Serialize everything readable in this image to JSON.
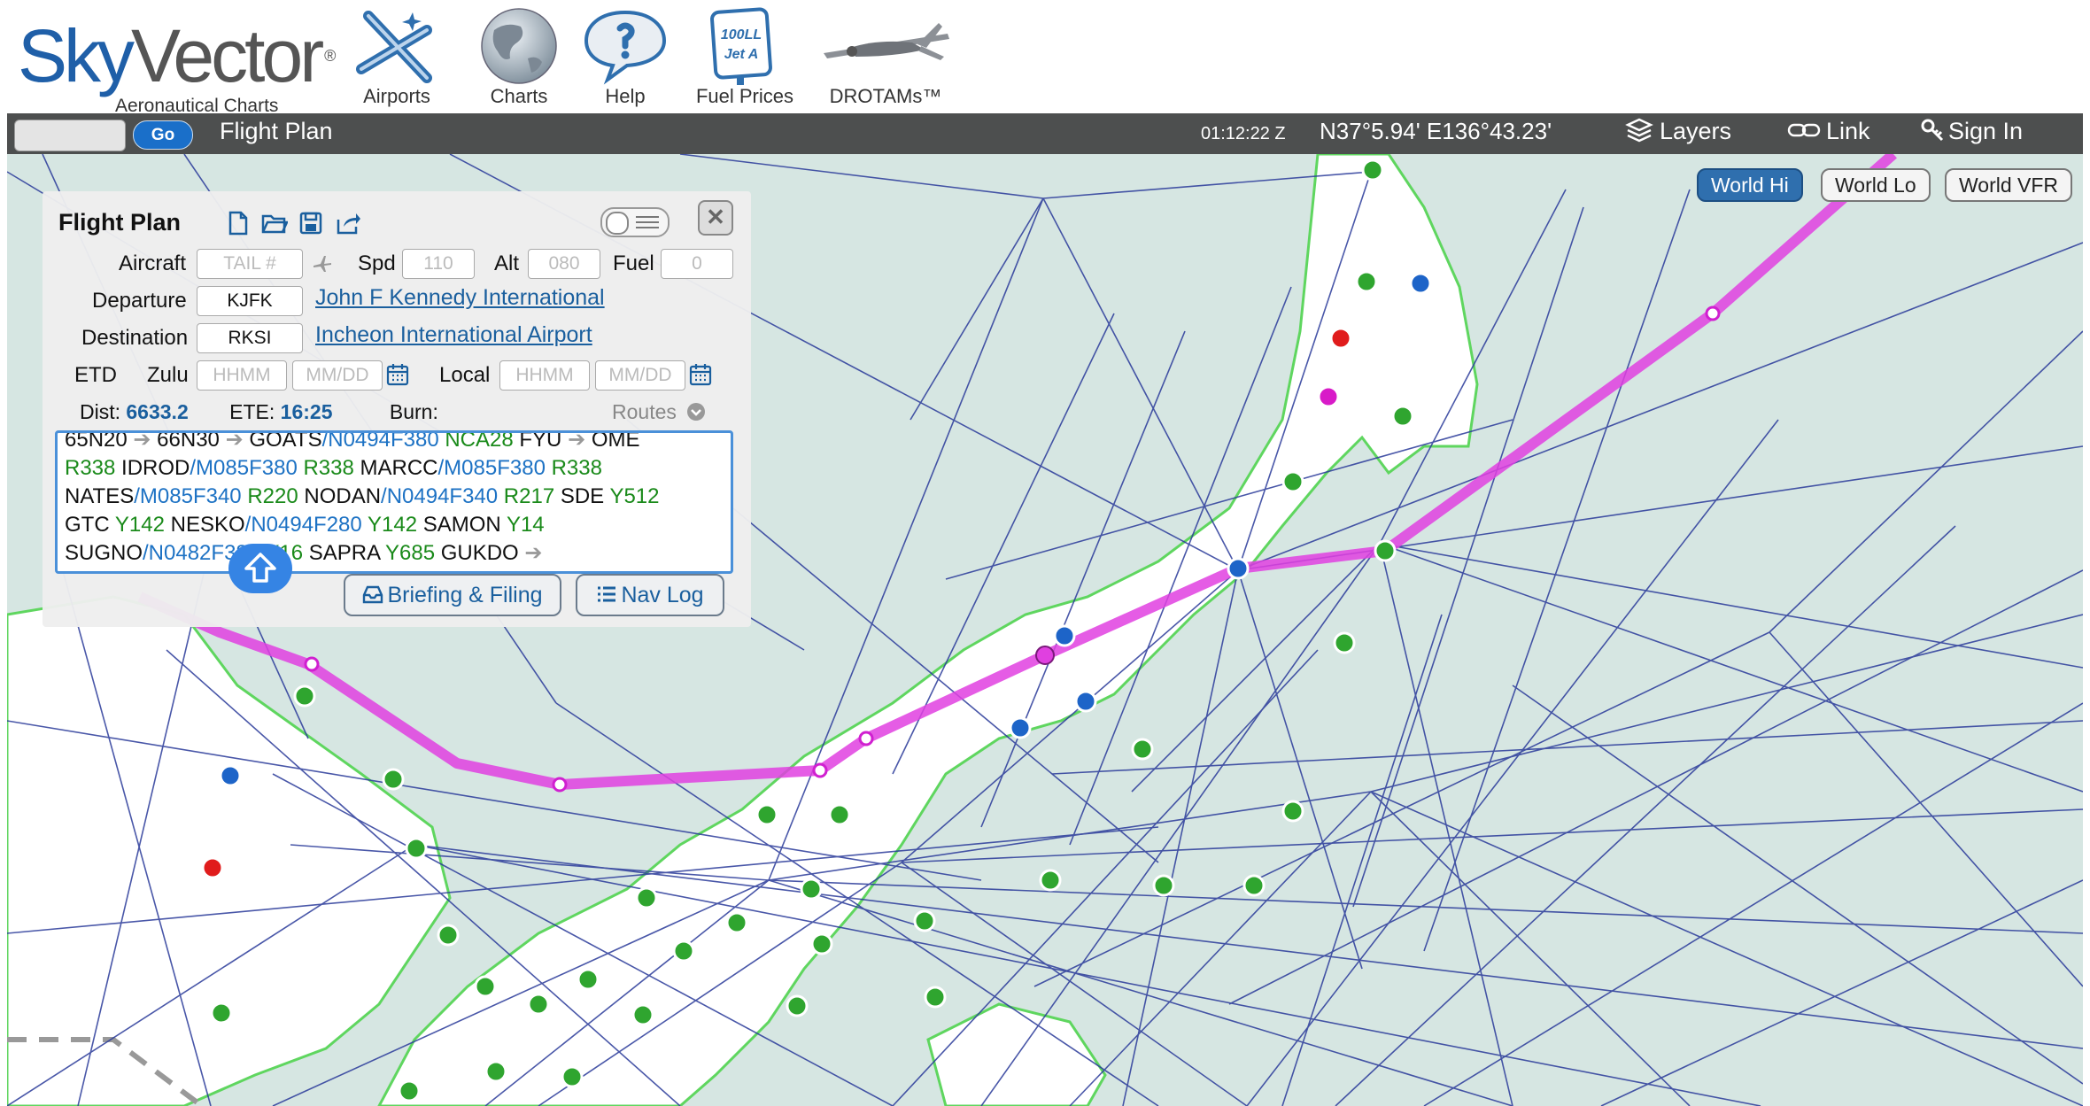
{
  "header": {
    "logo_sky": "Sky",
    "logo_vector": "Vector",
    "logo_reg": "®",
    "logo_subtitle": "Aeronautical Charts",
    "nav": [
      {
        "label": "Airports",
        "icon": "airports-icon"
      },
      {
        "label": "Charts",
        "icon": "globe-icon"
      },
      {
        "label": "Help",
        "icon": "help-bubble-icon"
      },
      {
        "label": "Fuel Prices",
        "icon": "fuel-sign-icon",
        "sign_top": "100LL",
        "sign_bottom": "Jet A"
      },
      {
        "label": "DROTAMs™",
        "icon": "drone-icon"
      }
    ]
  },
  "toolbar": {
    "search_placeholder": "",
    "go_label": "Go",
    "flight_plan_label": "Flight Plan",
    "clock": "01:12:22 Z",
    "coordinates": "N37°5.94' E136°43.23'",
    "layers_label": "Layers",
    "link_label": "Link",
    "signin_label": "Sign In"
  },
  "chart_buttons": [
    {
      "label": "World Hi",
      "active": true
    },
    {
      "label": "World Lo",
      "active": false
    },
    {
      "label": "World VFR",
      "active": false
    }
  ],
  "flight_plan": {
    "title": "Flight Plan",
    "aircraft_label": "Aircraft",
    "aircraft_placeholder": "TAIL #",
    "spd_label": "Spd",
    "spd_placeholder": "110",
    "alt_label": "Alt",
    "alt_placeholder": "080",
    "fuel_label": "Fuel",
    "fuel_placeholder": "0",
    "departure_label": "Departure",
    "departure_code": "KJFK",
    "departure_name": "John F Kennedy International",
    "destination_label": "Destination",
    "destination_code": "RKSI",
    "destination_name": "Incheon International Airport",
    "etd_label": "ETD",
    "zulu_label": "Zulu",
    "time_placeholder": "HHMM",
    "date_placeholder": "MM/DD",
    "local_label": "Local",
    "dist_label": "Dist:",
    "dist_value": "6633.2",
    "ete_label": "ETE:",
    "ete_value": "16:25",
    "burn_label": "Burn:",
    "routes_label": "Routes",
    "route_lines": [
      [
        [
          "k",
          "65N20 "
        ],
        [
          "a",
          "➔ "
        ],
        [
          "k",
          "66N30 "
        ],
        [
          "a",
          "➔ "
        ],
        [
          "k",
          "GOATS"
        ],
        [
          "b",
          "/N0494F380 "
        ],
        [
          "g",
          "NCA28 "
        ],
        [
          "k",
          "FYU "
        ],
        [
          "a",
          "➔ "
        ],
        [
          "k",
          "OME"
        ]
      ],
      [
        [
          "g",
          "R338 "
        ],
        [
          "k",
          "IDROD"
        ],
        [
          "b",
          "/M085F380 "
        ],
        [
          "g",
          "R338 "
        ],
        [
          "k",
          "MARCC"
        ],
        [
          "b",
          "/M085F380 "
        ],
        [
          "g",
          "R338"
        ]
      ],
      [
        [
          "k",
          "NATES"
        ],
        [
          "b",
          "/M085F340 "
        ],
        [
          "g",
          "R220 "
        ],
        [
          "k",
          "NODAN"
        ],
        [
          "b",
          "/N0494F340 "
        ],
        [
          "g",
          "R217 "
        ],
        [
          "k",
          "SDE "
        ],
        [
          "g",
          "Y512"
        ]
      ],
      [
        [
          "k",
          "GTC "
        ],
        [
          "g",
          "Y142 "
        ],
        [
          "k",
          "NESKO"
        ],
        [
          "b",
          "/N0494F280 "
        ],
        [
          "g",
          "Y142 "
        ],
        [
          "k",
          "SAMON "
        ],
        [
          "g",
          "Y14"
        ]
      ],
      [
        [
          "k",
          "SUGNO"
        ],
        [
          "b",
          "/N0482F380 "
        ],
        [
          "g",
          "Y16 "
        ],
        [
          "k",
          "SAPRA "
        ],
        [
          "g",
          "Y685 "
        ],
        [
          "k",
          "GUKDO "
        ],
        [
          "a",
          "➔"
        ]
      ]
    ],
    "briefing_label": "Briefing & Filing",
    "navlog_label": "Nav Log"
  },
  "colors": {
    "toolbar_bg": "#4d4f4f",
    "map_water": "#d6e6e2",
    "route_line": "#e040e0",
    "airway": "#2a3a9a",
    "airport_green": "#2fa52f",
    "airport_blue": "#1d64c8",
    "airport_red": "#e01c1c"
  }
}
